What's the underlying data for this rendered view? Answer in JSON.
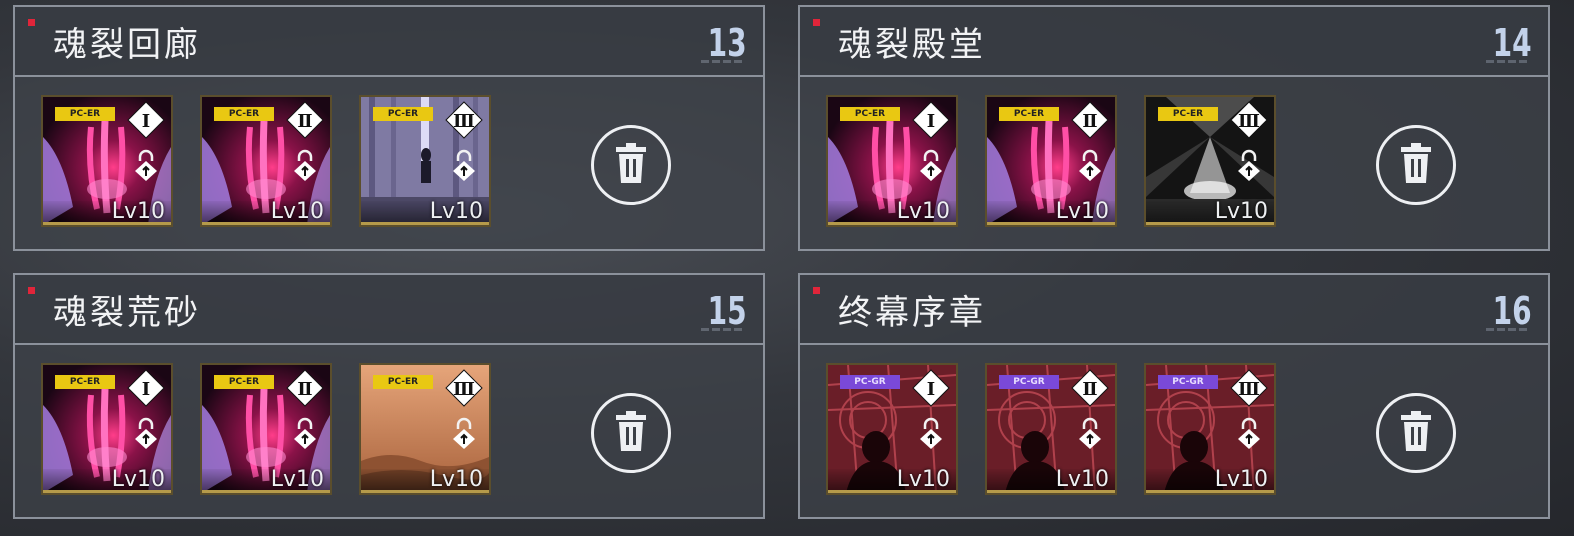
{
  "panels": [
    {
      "title": "魂裂回廊",
      "number": "13",
      "cards": [
        {
          "tag": "PC-ER",
          "tier": "Ⅰ",
          "level": "Lv10",
          "art": "crimson-claw"
        },
        {
          "tag": "PC-ER",
          "tier": "Ⅱ",
          "level": "Lv10",
          "art": "crimson-claw"
        },
        {
          "tag": "PC-ER",
          "tier": "Ⅲ",
          "level": "Lv10",
          "art": "pale-corridor"
        }
      ]
    },
    {
      "title": "魂裂殿堂",
      "number": "14",
      "cards": [
        {
          "tag": "PC-ER",
          "tier": "Ⅰ",
          "level": "Lv10",
          "art": "crimson-claw"
        },
        {
          "tag": "PC-ER",
          "tier": "Ⅱ",
          "level": "Lv10",
          "art": "crimson-claw"
        },
        {
          "tag": "PC-ER",
          "tier": "Ⅲ",
          "level": "Lv10",
          "art": "light-beam"
        }
      ]
    },
    {
      "title": "魂裂荒砂",
      "number": "15",
      "cards": [
        {
          "tag": "PC-ER",
          "tier": "Ⅰ",
          "level": "Lv10",
          "art": "crimson-claw"
        },
        {
          "tag": "PC-ER",
          "tier": "Ⅱ",
          "level": "Lv10",
          "art": "crimson-claw"
        },
        {
          "tag": "PC-ER",
          "tier": "Ⅲ",
          "level": "Lv10",
          "art": "desert-sand"
        }
      ]
    },
    {
      "title": "终幕序章",
      "number": "16",
      "cards": [
        {
          "tag": "PC-GR",
          "tier": "Ⅰ",
          "level": "Lv10",
          "art": "red-window"
        },
        {
          "tag": "PC-GR",
          "tier": "Ⅱ",
          "level": "Lv10",
          "art": "red-window"
        },
        {
          "tag": "PC-GR",
          "tier": "Ⅲ",
          "level": "Lv10",
          "art": "red-window"
        }
      ]
    }
  ],
  "icons": {
    "delete": "trash-icon",
    "lock": "lock-icon",
    "tier": "diamond-tier-icon"
  },
  "colors": {
    "accent_red": "#e0253a",
    "badge_er": "#e9c812",
    "badge_gr": "#7a49d8",
    "panel_border": "#8b919b",
    "number_text": "#c3d2ea"
  }
}
